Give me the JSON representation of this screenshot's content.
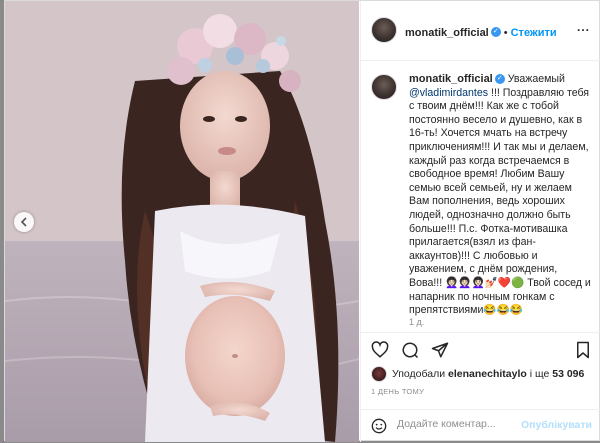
{
  "post": {
    "username": "monatik_official",
    "follow_label": "Стежити",
    "more_label": "...",
    "verified_icon": "verified-badge-icon",
    "caption": {
      "username": "monatik_official",
      "greeting": "Уважаемый",
      "mention": "@vladimirdantes",
      "text_1": "!!! Поздравляю тебя с твоим днём!!! Как же с тобой постоянно весело и душевно, как в 16-ть! Хочется мчать на встречу приключениям!!! И так мы и делаем, каждый раз когда встречаемся в свободное время! Любим Вашу семью всей семьей, ну и желаем Вам пополнения, ведь хороших людей, однозначно должно быть больше!!! П.с. Фотка-мотивашка прилагается(взял из фан-аккаунтов)!!! С любовью и уважением, с днём рождения, Вова!!!",
      "emojis_1": "👩🏻‍🦱👩🏻‍🦱👩🏻‍🦱💅🏻❤️🟢",
      "text_2": "Твой сосед и напарник по ночным гонкам с препятствиями",
      "emojis_2": "😂😂😂"
    },
    "caption_time": "1 д.",
    "likes": {
      "prefix": "Уподобали",
      "user": "elenanechitaylo",
      "suffix": "і ще",
      "count": "53 096"
    },
    "date": "1 ДЕНЬ ТОМУ",
    "comment_placeholder": "Додайте коментар...",
    "publish_label": "Опублікувати"
  },
  "icons": {
    "like": "heart-icon",
    "comment": "comment-icon",
    "share": "share-icon",
    "save": "bookmark-icon",
    "prev": "chevron-left-icon",
    "emoji": "smiley-icon"
  }
}
